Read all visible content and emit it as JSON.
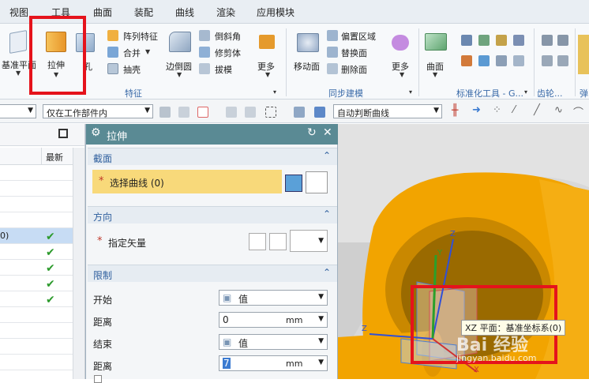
{
  "menubar": {
    "items": [
      "视图",
      "工具",
      "曲面",
      "装配",
      "曲线",
      "渲染",
      "应用模块"
    ]
  },
  "ribbon": {
    "datum_plane_label": "基准平面",
    "extrude_label": "拉伸",
    "hole_label": "孔",
    "pattern_feature_label": "阵列特征",
    "unite_label": "合并",
    "shell_label": "抽壳",
    "edge_blend_label": "边倒圆",
    "chamfer_label": "倒斜角",
    "trim_body_label": "修剪体",
    "draft_label": "拔模",
    "more_label_1": "更多",
    "move_face_label": "移动面",
    "offset_region_label": "偏置区域",
    "replace_face_label": "替换面",
    "delete_face_label": "删除面",
    "more_label_2": "更多",
    "surface_label": "曲面",
    "group_feature": "特征",
    "group_sync": "同步建模",
    "group_std_parts": "标准化工具 - G...",
    "group_gear": "齿轮...",
    "group_spring": "弹"
  },
  "toolbar": {
    "scope_filter": "仅在工作部件内",
    "curve_rule": "自动判断曲线"
  },
  "navigator": {
    "col_latest": "最新",
    "selected_row_text": "0)",
    "checks": [
      "✔",
      "✔",
      "✔",
      "✔",
      "✔"
    ]
  },
  "dialog": {
    "title": "拉伸",
    "section_label": "截面",
    "select_curve": "选择曲线 (0)",
    "direction_label": "方向",
    "specify_vector": "指定矢量",
    "limits_label": "限制",
    "start_label": "开始",
    "start_value": "值",
    "start_distance_label": "距离",
    "start_distance": "0",
    "unit_mm_1": "mm",
    "end_label": "结束",
    "end_value": "值",
    "end_distance_label": "距离",
    "end_distance": "7",
    "unit_mm_2": "mm",
    "required_mark": "*"
  },
  "viewport": {
    "coord_tag": "XZ 平面：基准坐标系(0)",
    "axis_x": "X",
    "axis_y": "Y",
    "axis_z": "Z",
    "watermark": "Bai 经验",
    "watermark_url": "jingyan.baidu.com"
  },
  "colors": {
    "highlight": "#e5131c",
    "part": "#f2a400",
    "dialog_header": "#5a8a94",
    "selected_row": "#c7dcf4"
  }
}
